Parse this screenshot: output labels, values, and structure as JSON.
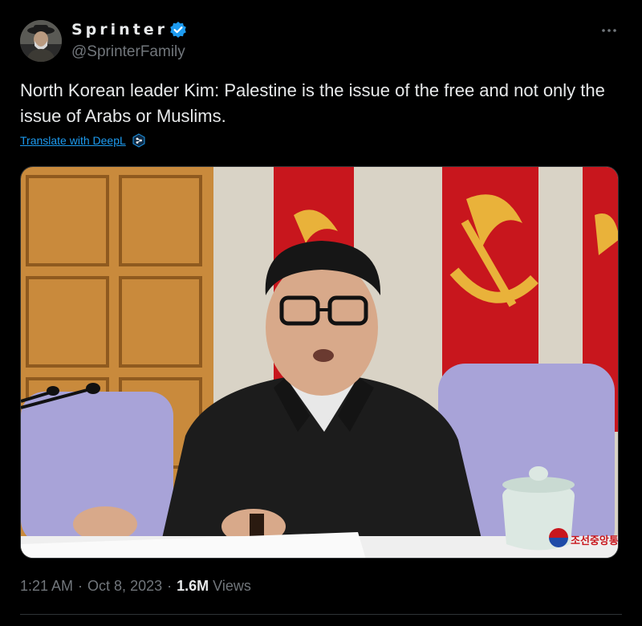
{
  "author": {
    "display_name": "Sprinter",
    "handle": "@SprinterFamily",
    "verified": true,
    "avatar_icon": "profile-avatar"
  },
  "more_options_icon": "ellipsis-icon",
  "tweet": {
    "text": "North Korean leader Kim: Palestine is the issue of the free and not only the issue of Arabs or Muslims.",
    "translate_label": "Translate with DeepL",
    "media_watermark": "조선중앙통신"
  },
  "meta": {
    "time": "1:21 AM",
    "separator": "·",
    "date": "Oct 8, 2023",
    "views_count": "1.6M",
    "views_label": "Views"
  },
  "colors": {
    "background": "#000000",
    "text": "#e7e9ea",
    "secondary": "#71767b",
    "link": "#1d9bf0",
    "verified": "#1d9bf0"
  }
}
